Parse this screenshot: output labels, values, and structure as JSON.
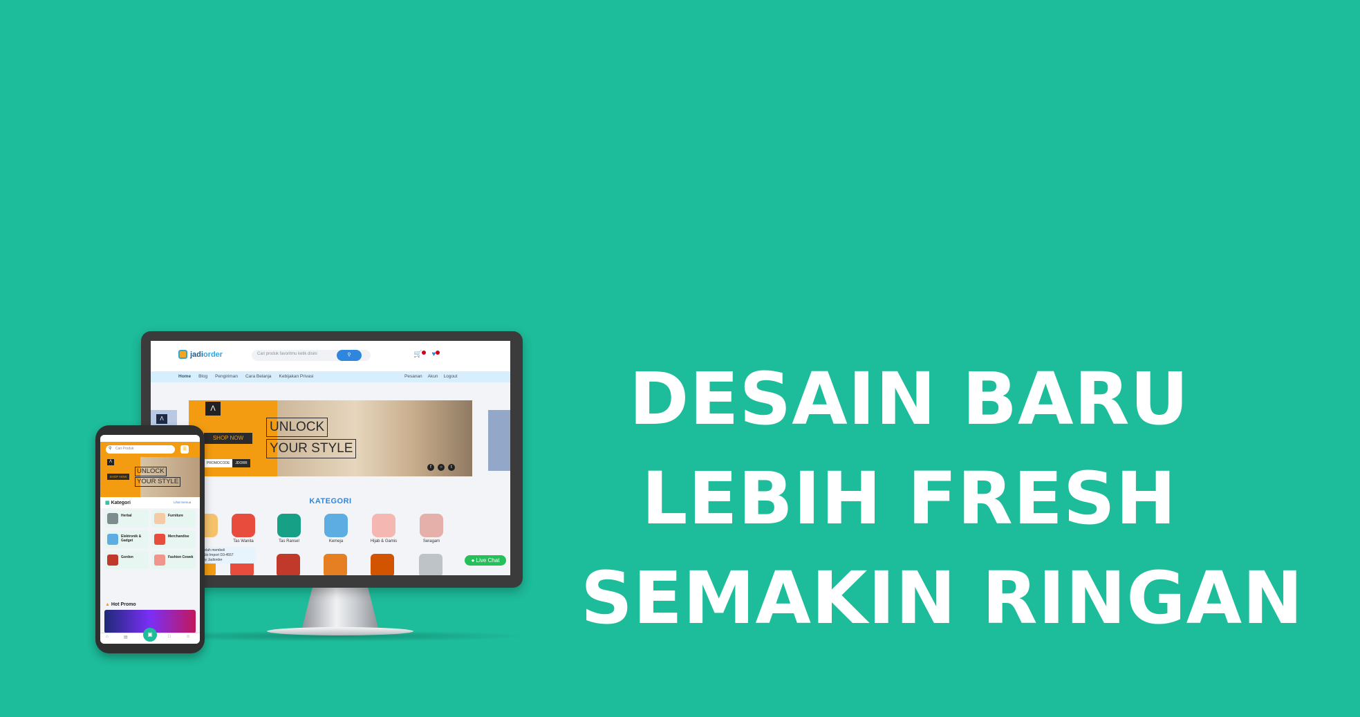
{
  "headline": {
    "line1": "DESAIN BARU",
    "line2": "LEBIH FRESH",
    "line3": "SEMAKIN RINGAN"
  },
  "colors": {
    "background": "#1dbc9a",
    "brand_blue": "#2e86de",
    "accent_orange": "#f39c12",
    "chat_green": "#25c05a"
  },
  "desktop": {
    "logo": {
      "prefix": "jadi",
      "suffix": "order"
    },
    "search_placeholder": "Cari produk favoritmu ketik disini",
    "search_button_icon": "search-icon",
    "nav_left": [
      "Home",
      "Blog",
      "Pengiriman",
      "Cara Belanja",
      "Kebijakan Privasi"
    ],
    "nav_right": [
      "Pesanan",
      "Akun",
      "Logout"
    ],
    "banner": {
      "unlock_line1": "UNLOCK",
      "unlock_line2": "YOUR STYLE",
      "shop_now": "SHOP NOW",
      "promocode_label": "PROMOCODE",
      "promocode_value": "JDORR"
    },
    "kategori_title": "KATEGORI",
    "categories": [
      "",
      "Tas Wanita",
      "Tas Ransel",
      "Kemeja",
      "Hijab & Gamis",
      "Seragam"
    ],
    "toast": {
      "line1": "telah membeli",
      "line2": "Sto Import D3-4557",
      "line3": "by Jadiorder"
    },
    "live_chat": "Live Chat"
  },
  "mobile": {
    "search_placeholder": "Cari Produk",
    "banner": {
      "unlock_line1": "UNLOCK",
      "unlock_line2": "YOUR STYLE",
      "shop_now": "SHOP NOW"
    },
    "kategori_title": "Kategori",
    "lihat_semua": "Lihat Semua",
    "categories": [
      "Herbal",
      "Furniture",
      "Elektronik & Gadget",
      "Merchandise",
      "Gorden",
      "Fashion Cewek"
    ],
    "hot_promo": "Hot Promo"
  }
}
